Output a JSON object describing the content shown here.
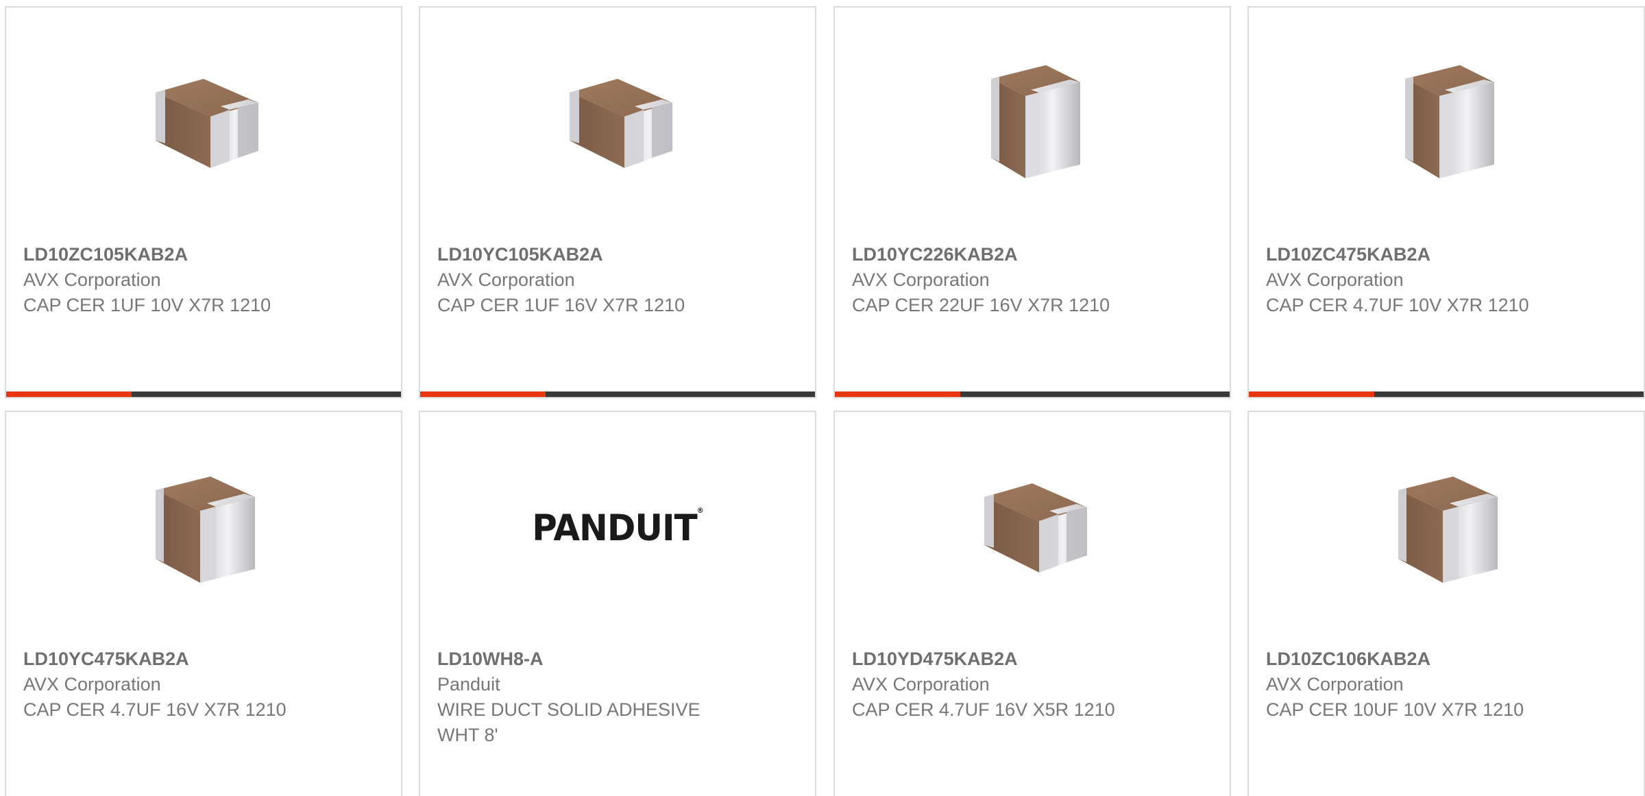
{
  "colors": {
    "accent": "#e8380d",
    "bar_dark": "#3a3a3a",
    "card_border": "#dcdcdc",
    "text": "#777777"
  },
  "products": [
    {
      "part_number": "LD10ZC105KAB2A",
      "manufacturer": "AVX Corporation",
      "description": "CAP CER 1UF 10V X7R 1210",
      "image": "ceramic-capacitor-chip-icon"
    },
    {
      "part_number": "LD10YC105KAB2A",
      "manufacturer": "AVX Corporation",
      "description": "CAP CER 1UF 16V X7R 1210",
      "image": "ceramic-capacitor-chip-icon"
    },
    {
      "part_number": "LD10YC226KAB2A",
      "manufacturer": "AVX Corporation",
      "description": "CAP CER 22UF 16V X7R 1210",
      "image": "ceramic-capacitor-chip-icon"
    },
    {
      "part_number": "LD10ZC475KAB2A",
      "manufacturer": "AVX Corporation",
      "description": "CAP CER 4.7UF 10V X7R 1210",
      "image": "ceramic-capacitor-chip-icon"
    },
    {
      "part_number": "LD10YC475KAB2A",
      "manufacturer": "AVX Corporation",
      "description": "CAP CER 4.7UF 16V X7R 1210",
      "image": "ceramic-capacitor-chip-icon"
    },
    {
      "part_number": "LD10WH8-A",
      "manufacturer": "Panduit",
      "description": "WIRE DUCT SOLID ADHESIVE WHT 8'",
      "image": "panduit-logo",
      "logo_text": "PANDUIT"
    },
    {
      "part_number": "LD10YD475KAB2A",
      "manufacturer": "AVX Corporation",
      "description": "CAP CER 4.7UF 16V X5R 1210",
      "image": "ceramic-capacitor-chip-icon"
    },
    {
      "part_number": "LD10ZC106KAB2A",
      "manufacturer": "AVX Corporation",
      "description": "CAP CER 10UF 10V X7R 1210",
      "image": "ceramic-capacitor-chip-icon"
    }
  ]
}
